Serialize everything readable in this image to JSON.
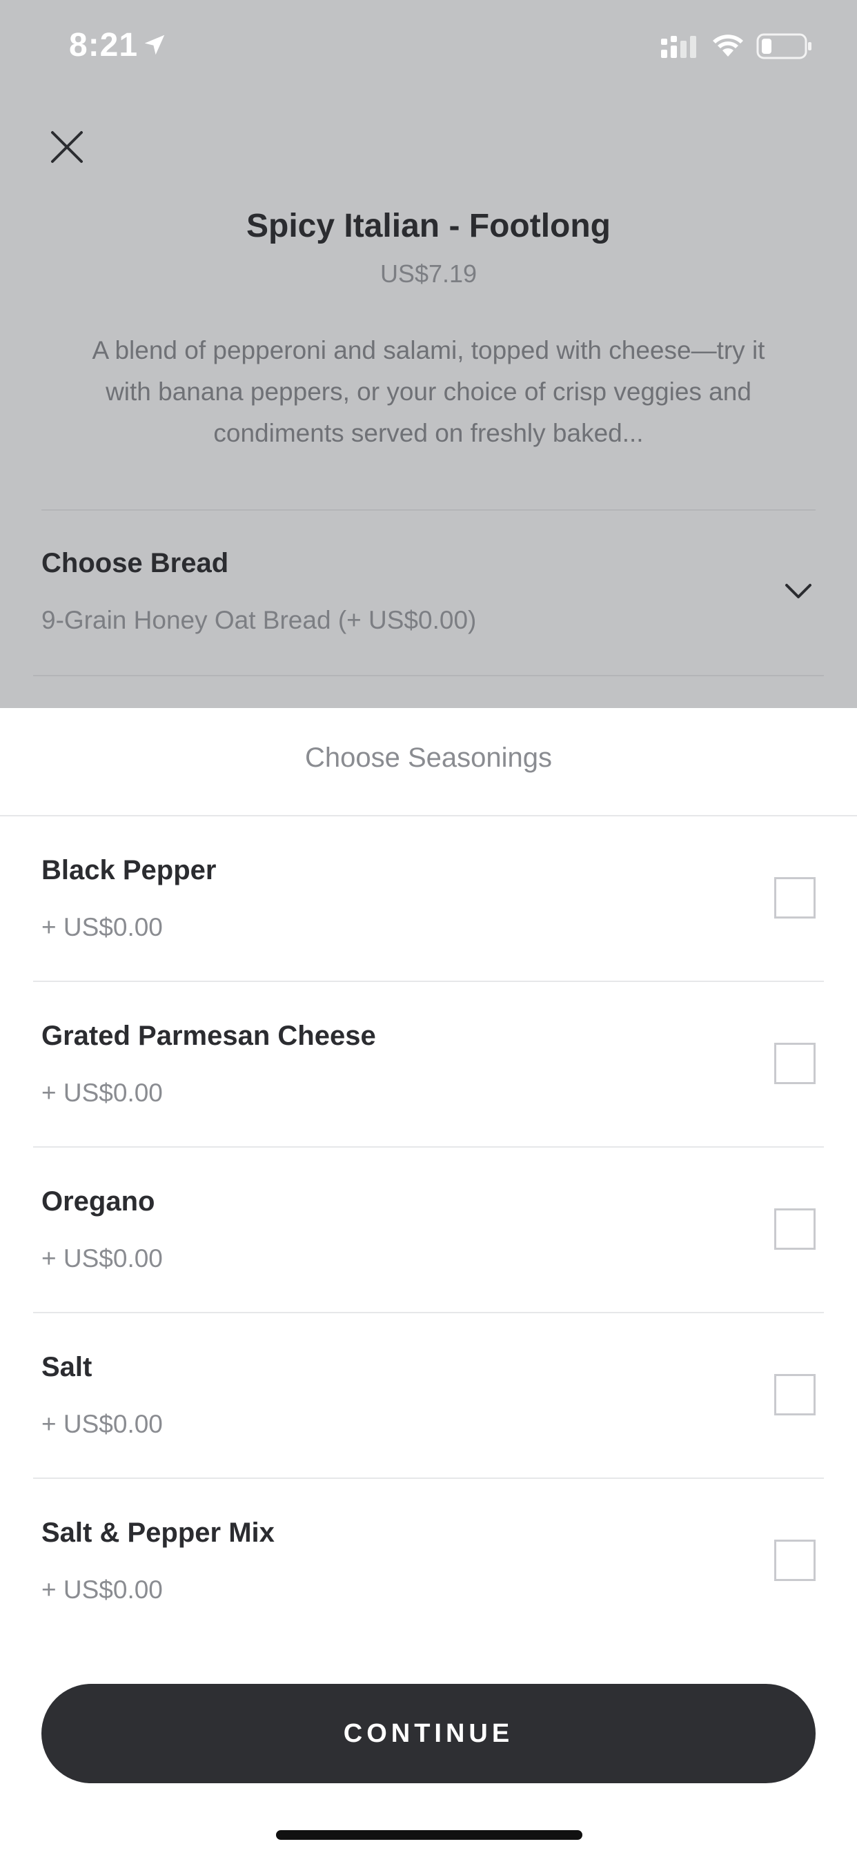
{
  "status_bar": {
    "time": "8:21",
    "icons": [
      "location-arrow-icon",
      "signal-icon",
      "wifi-icon",
      "battery-icon"
    ]
  },
  "item": {
    "title": "Spicy Italian - Footlong",
    "price": "US$7.19",
    "description": "A blend of pepperoni and salami, topped with cheese—try it with banana peppers, or your choice of crisp veggies and condiments served on freshly baked..."
  },
  "bread": {
    "label": "Choose Bread",
    "selected": "9-Grain Honey Oat Bread (+ US$0.00)"
  },
  "sheet": {
    "title": "Choose Seasonings",
    "options": [
      {
        "name": "Black Pepper",
        "price": "+ US$0.00",
        "checked": false
      },
      {
        "name": "Grated Parmesan Cheese",
        "price": "+ US$0.00",
        "checked": false
      },
      {
        "name": "Oregano",
        "price": "+ US$0.00",
        "checked": false
      },
      {
        "name": "Salt",
        "price": "+ US$0.00",
        "checked": false
      },
      {
        "name": "Salt & Pepper Mix",
        "price": "+ US$0.00",
        "checked": false
      }
    ],
    "continue_label": "CONTINUE"
  },
  "colors": {
    "overlay_bg": "#c1c2c4",
    "button_bg": "#2e2f33",
    "text_primary": "#2b2c30",
    "text_secondary": "#8a8c91"
  }
}
